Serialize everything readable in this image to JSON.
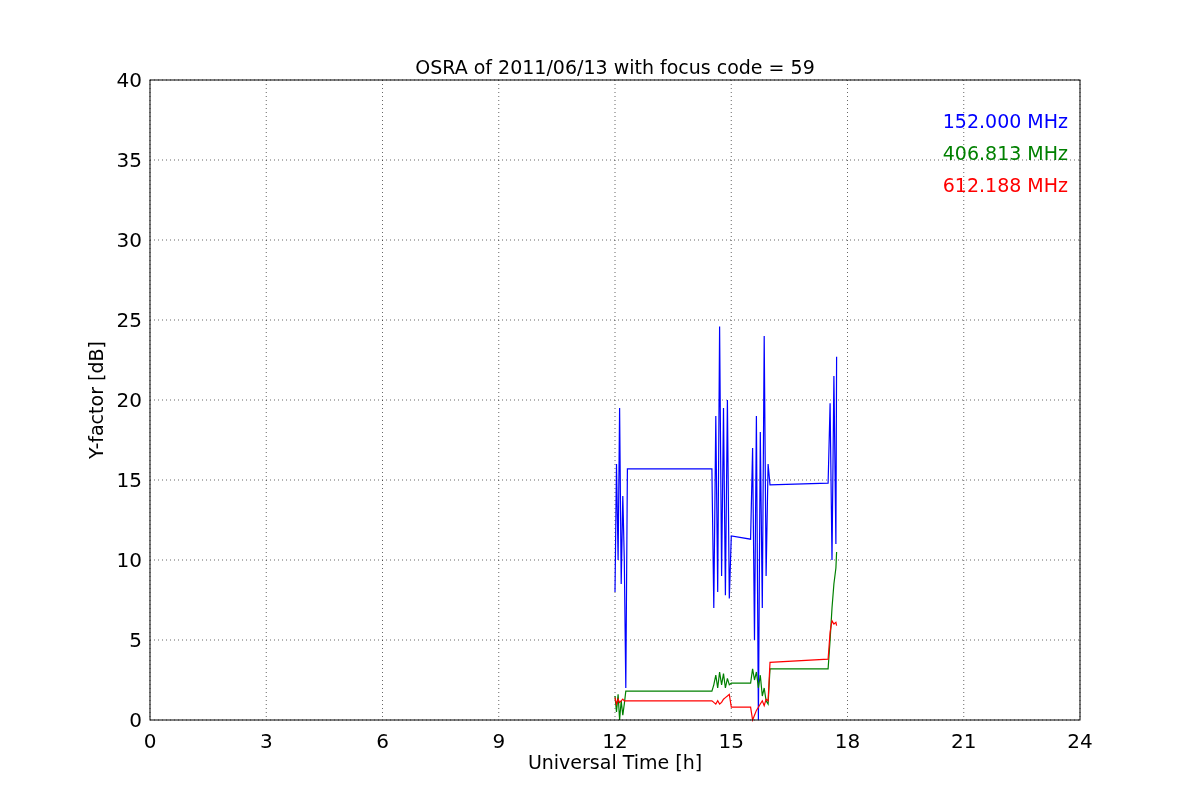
{
  "figure": {
    "chart_data": {
      "type": "line",
      "title": "OSRA of 2011/06/13 with focus code = 59",
      "xlabel": "Universal Time [h]",
      "ylabel": "Y-factor [dB]",
      "grid": true,
      "xlim": [
        0,
        24
      ],
      "ylim": [
        0,
        40
      ],
      "xticks": [
        0,
        3,
        6,
        9,
        12,
        15,
        18,
        21,
        24
      ],
      "yticks": [
        0,
        5,
        10,
        15,
        20,
        25,
        30,
        35,
        40
      ],
      "x": [
        12.0,
        12.04,
        12.08,
        12.12,
        12.16,
        12.2,
        12.24,
        12.28,
        12.32,
        14.5,
        14.55,
        14.6,
        14.65,
        14.7,
        14.75,
        14.8,
        14.85,
        14.9,
        14.95,
        15.0,
        15.5,
        15.55,
        15.6,
        15.65,
        15.7,
        15.75,
        15.8,
        15.85,
        15.9,
        15.95,
        16.0,
        17.5,
        17.55,
        17.6,
        17.65,
        17.7,
        17.72
      ],
      "series": [
        {
          "name": "152.000 MHz",
          "color": "#0000ff",
          "values": [
            8,
            16,
            10,
            19.5,
            8.5,
            14,
            10,
            2,
            15.7,
            15.7,
            7,
            19,
            8,
            24.6,
            9,
            19.5,
            7.8,
            20,
            7.6,
            11.5,
            11.3,
            17,
            5,
            19,
            0,
            18,
            7,
            24,
            9,
            16,
            14.7,
            14.8,
            19.8,
            10,
            21.5,
            11,
            22.7
          ]
        },
        {
          "name": "406.813 MHz",
          "color": "#008000",
          "values": [
            1.5,
            0.5,
            1.6,
            0,
            1.2,
            0.3,
            1.0,
            1.8,
            1.8,
            1.8,
            2.2,
            2.8,
            2.0,
            3.0,
            2.2,
            2.9,
            2.0,
            2.6,
            2.2,
            2.3,
            2.3,
            3.2,
            2.5,
            3.0,
            2.0,
            2.8,
            1.5,
            2.0,
            1.2,
            1.0,
            3.2,
            3.2,
            5,
            7,
            8.5,
            9.5,
            10.5
          ]
        },
        {
          "name": "612.188 MHz",
          "color": "#ff0000",
          "values": [
            1.4,
            1.0,
            1.3,
            1.1,
            1.2,
            1.3,
            1.2,
            1.2,
            1.2,
            1.2,
            1.1,
            1.0,
            1.2,
            1.0,
            1.1,
            1.3,
            1.4,
            1.5,
            1.6,
            0.8,
            0.8,
            0,
            0.3,
            0.6,
            0.8,
            1.0,
            1.2,
            0.9,
            1.3,
            1.2,
            3.6,
            3.8,
            5.5,
            6.2,
            6.0,
            6.1,
            5.9
          ]
        }
      ]
    }
  }
}
